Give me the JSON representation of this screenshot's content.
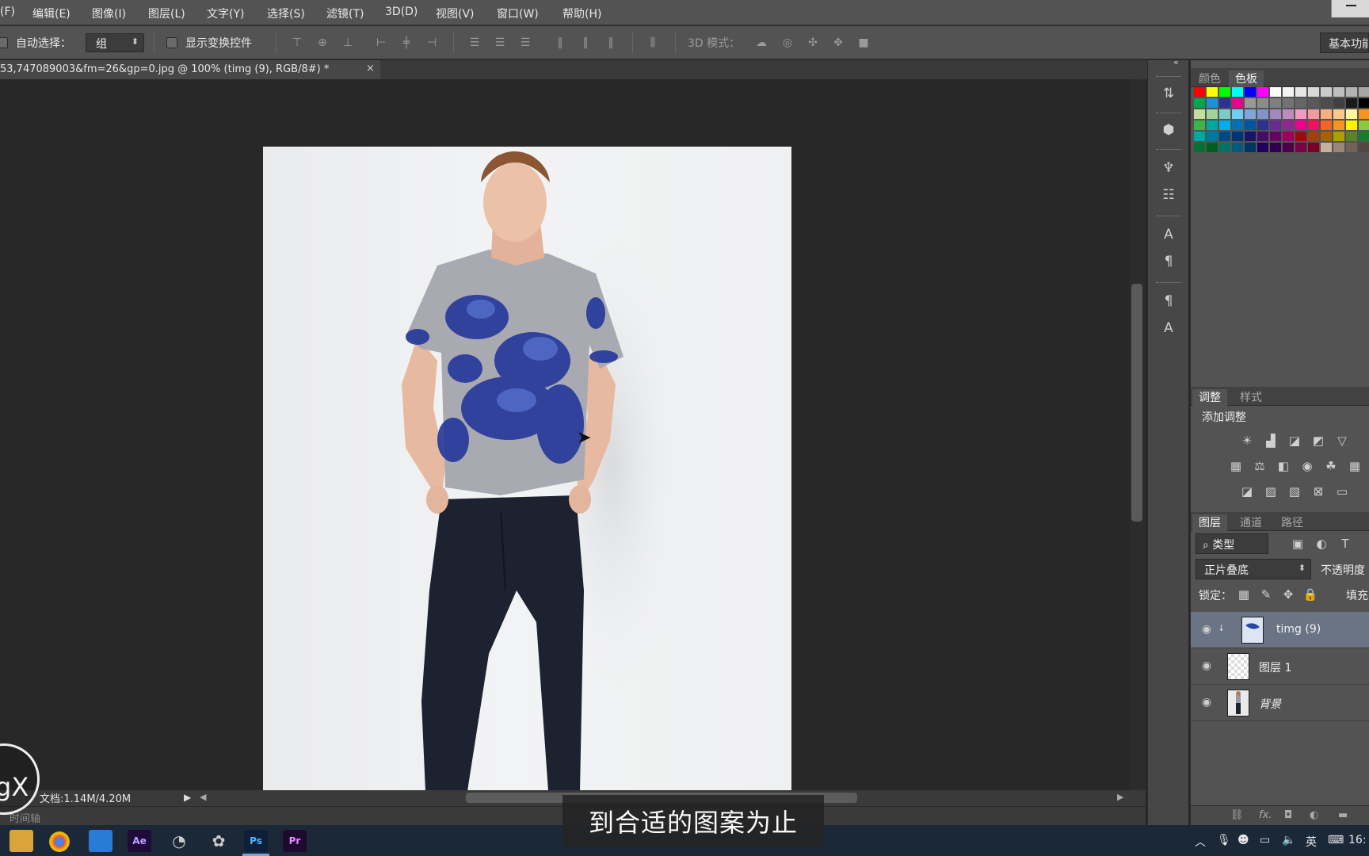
{
  "menubar": {
    "items": [
      "(F)",
      "编辑(E)",
      "图像(I)",
      "图层(L)",
      "文字(Y)",
      "选择(S)",
      "滤镜(T)",
      "3D(D)",
      "视图(V)",
      "窗口(W)",
      "帮助(H)"
    ]
  },
  "options": {
    "auto_select_label": "自动选择：",
    "group_value": "组",
    "show_transform_label": "显示变换控件",
    "mode3d_label": "3D 模式：",
    "workspace_label": "基本功能"
  },
  "document": {
    "tab_title": "53,747089003&fm=26&gp=0.jpg @ 100% (timg (9), RGB/8#) *",
    "tab_close": "×",
    "info": "文档:1.14M/4.20M"
  },
  "timeline": {
    "label": "时间轴"
  },
  "panels": {
    "color_tab": "颜色",
    "swatches_tab": "色板",
    "adjust_tab": "调整",
    "styles_tab": "样式",
    "add_adjustment": "添加调整",
    "layers_tab": "图层",
    "channels_tab": "通道",
    "paths_tab": "路径",
    "filter_kind": "类型",
    "blend_mode": "正片叠底",
    "opacity_label": "不透明度",
    "lock_label": "锁定：",
    "fill_label": "填充"
  },
  "layers": [
    {
      "name": "timg (9)",
      "selected": true
    },
    {
      "name": "图层 1",
      "selected": false
    },
    {
      "name": "背景",
      "selected": false
    }
  ],
  "taskbar": {
    "apps": [
      "Ae",
      "Ps",
      "Pr"
    ],
    "tray_lang": "英",
    "clock": "16:"
  },
  "subtitle": "到合适的图案为止",
  "logo_text": "gX",
  "swatch_colors": [
    "#ff0000",
    "#ffff00",
    "#00ff00",
    "#00ffff",
    "#0000ff",
    "#ff00ff",
    "#ffffff",
    "#f2f2f2",
    "#e6e6e6",
    "#d9d9d9",
    "#cccccc",
    "#bfbfbf",
    "#b3b3b3",
    "#a6a6a6",
    "#00a650",
    "#1f8fd8",
    "#2e3192",
    "#ec008c",
    "#999999",
    "#8c8c8c",
    "#808080",
    "#737373",
    "#666666",
    "#595959",
    "#4d4d4d",
    "#404040",
    "#1a1a1a",
    "#000000",
    "#c4df9b",
    "#a3d39c",
    "#7accc8",
    "#6dcff6",
    "#7da7d9",
    "#8393ca",
    "#a187be",
    "#bd8cbf",
    "#f49ac1",
    "#f6989d",
    "#f9ad81",
    "#fdc68a",
    "#fff79a",
    "#f7941d",
    "#39b54a",
    "#00a99d",
    "#00aeef",
    "#0072bc",
    "#0054a6",
    "#2e3192",
    "#662d91",
    "#92278f",
    "#ec008c",
    "#ed145b",
    "#f26522",
    "#f7941d",
    "#fff200",
    "#8dc63f",
    "#00a99d",
    "#0076a3",
    "#004a80",
    "#003471",
    "#1b1464",
    "#440e62",
    "#630460",
    "#9e005d",
    "#9e0b0f",
    "#a0410d",
    "#a36209",
    "#aba000",
    "#598527",
    "#1a7b30",
    "#007236",
    "#005e20",
    "#00736a",
    "#005b7f",
    "#003663",
    "#21005e",
    "#32004b",
    "#4b0049",
    "#7b0046",
    "#7a0026",
    "#c7b299",
    "#998675",
    "#736357",
    "#534741"
  ]
}
